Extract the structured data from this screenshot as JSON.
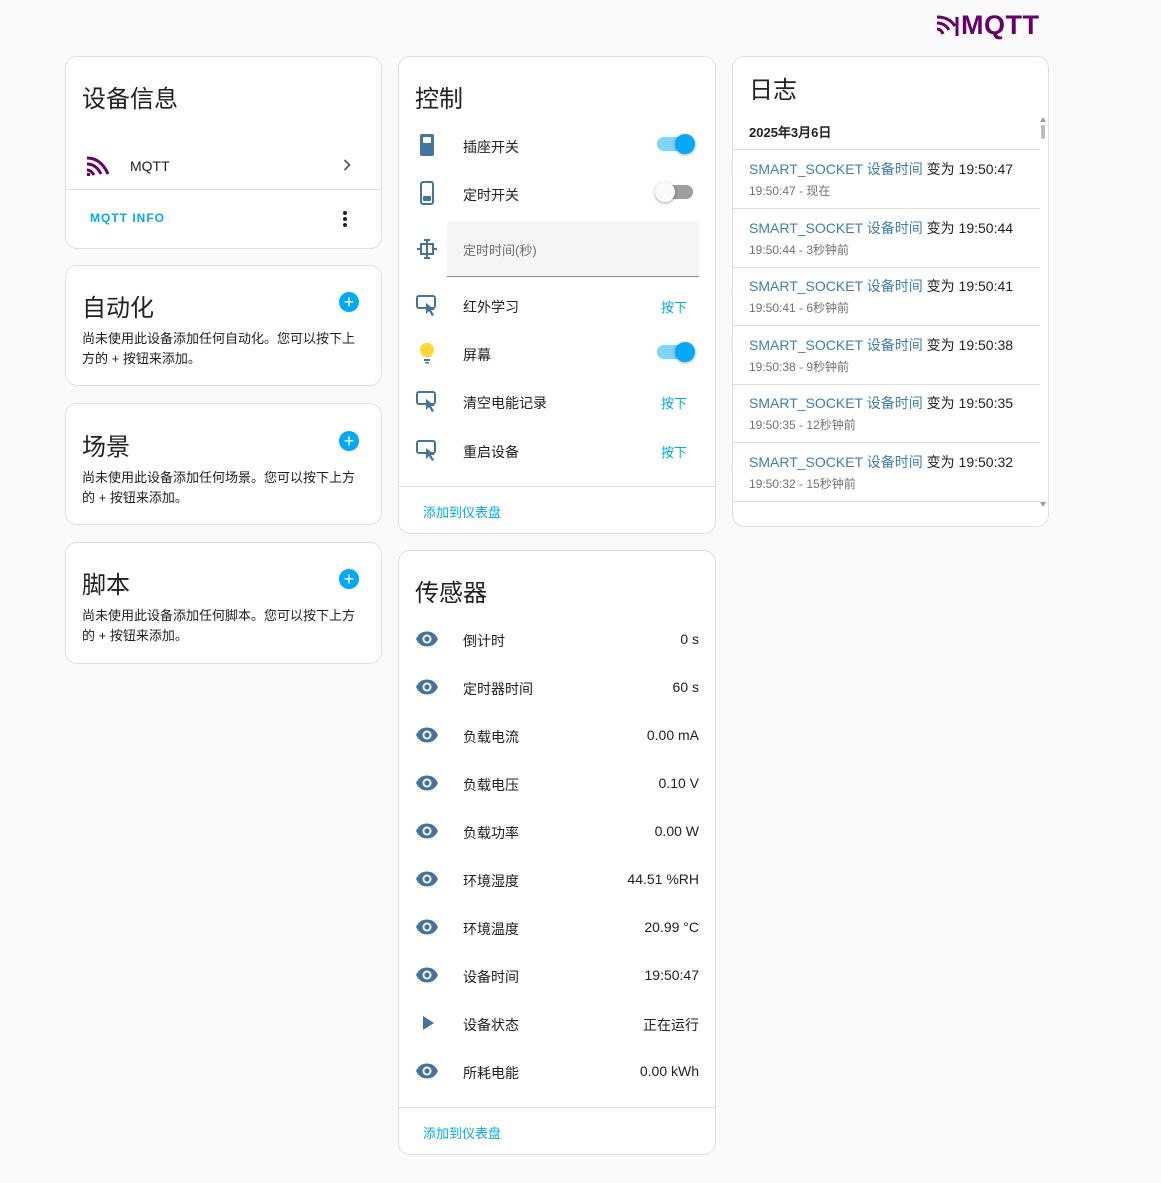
{
  "brand": {
    "text": "MQTT"
  },
  "device_info": {
    "title": "设备信息",
    "integration": "MQTT",
    "info_link": "MQTT INFO"
  },
  "automation": {
    "title": "自动化",
    "description": "尚未使用此设备添加任何自动化。您可以按下上方的 + 按钮来添加。"
  },
  "scenes": {
    "title": "场景",
    "description": "尚未使用此设备添加任何场景。您可以按下上方的 + 按钮来添加。"
  },
  "scripts": {
    "title": "脚本",
    "description": "尚未使用此设备添加任何脚本。您可以按下上方的 + 按钮来添加。"
  },
  "controls": {
    "title": "控制",
    "items": [
      {
        "name": "插座开关",
        "type": "switch",
        "state": "on"
      },
      {
        "name": "定时开关",
        "type": "switch",
        "state": "off"
      },
      {
        "name": "定时时间(秒)",
        "type": "number"
      },
      {
        "name": "红外学习",
        "type": "button",
        "action": "按下"
      },
      {
        "name": "屏幕",
        "type": "switch",
        "state": "on"
      },
      {
        "name": "清空电能记录",
        "type": "button",
        "action": "按下"
      },
      {
        "name": "重启设备",
        "type": "button",
        "action": "按下"
      }
    ],
    "footer": "添加到仪表盘"
  },
  "sensors": {
    "title": "传感器",
    "items": [
      {
        "name": "倒计时",
        "value": "0 s"
      },
      {
        "name": "定时器时间",
        "value": "60 s"
      },
      {
        "name": "负载电流",
        "value": "0.00 mA"
      },
      {
        "name": "负载电压",
        "value": "0.10 V"
      },
      {
        "name": "负载功率",
        "value": "0.00 W"
      },
      {
        "name": "环境湿度",
        "value": "44.51 %RH"
      },
      {
        "name": "环境温度",
        "value": "20.99 °C"
      },
      {
        "name": "设备时间",
        "value": "19:50:47"
      },
      {
        "name": "设备状态",
        "value": "正在运行"
      },
      {
        "name": "所耗电能",
        "value": "0.00 kWh"
      }
    ],
    "footer": "添加到仪表盘"
  },
  "logbook": {
    "title": "日志",
    "date": "2025年3月6日",
    "entries": [
      {
        "entity": "SMART_SOCKET 设备时间",
        "text": "变为 19:50:47",
        "time": "19:50:47 - 现在"
      },
      {
        "entity": "SMART_SOCKET 设备时间",
        "text": "变为 19:50:44",
        "time": "19:50:44 - 3秒钟前"
      },
      {
        "entity": "SMART_SOCKET 设备时间",
        "text": "变为 19:50:41",
        "time": "19:50:41 - 6秒钟前"
      },
      {
        "entity": "SMART_SOCKET 设备时间",
        "text": "变为 19:50:38",
        "time": "19:50:38 - 9秒钟前"
      },
      {
        "entity": "SMART_SOCKET 设备时间",
        "text": "变为 19:50:35",
        "time": "19:50:35 - 12秒钟前"
      },
      {
        "entity": "SMART_SOCKET 设备时间",
        "text": "变为 19:50:32",
        "time": "19:50:32 - 15秒钟前"
      }
    ]
  },
  "colors": {
    "accent": "#03a9f4",
    "brand": "#660066",
    "icon": "#44739e",
    "bulb": "#fdd835"
  }
}
